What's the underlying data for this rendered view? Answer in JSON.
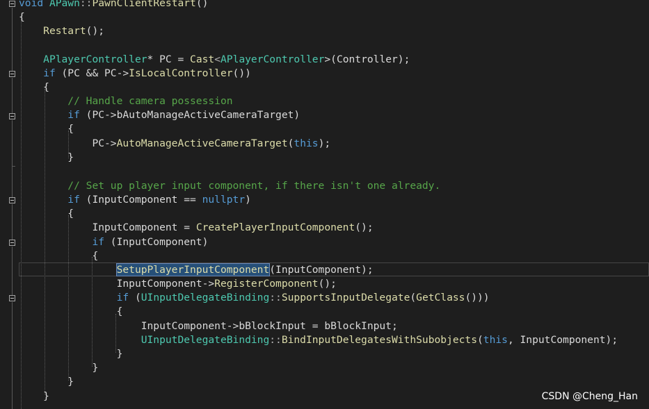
{
  "code": {
    "l1": {
      "kw": "void",
      "cls": "APawn",
      "sep": "::",
      "fn": "PawnClientRestart",
      "rest": "()"
    },
    "l2": "{",
    "l3": {
      "fn": "Restart",
      "rest": "();"
    },
    "l5": {
      "type": "APlayerController",
      "mid": "* PC = ",
      "cast": "Cast",
      "lt": "<",
      "type2": "APlayerController",
      "rest": ">(Controller);"
    },
    "l6": {
      "kw": "if",
      "a": " (PC && PC->",
      "fn": "IsLocalController",
      "b": "())"
    },
    "l7": "{",
    "l8": "// Handle camera possession",
    "l9": {
      "kw": "if",
      "a": " (PC->",
      "field": "bAutoManageActiveCameraTarget",
      "b": ")"
    },
    "l10": "{",
    "l11": {
      "a": "PC->",
      "fn": "AutoManageActiveCameraTarget",
      "b": "(",
      "kw": "this",
      "c": ");"
    },
    "l12": "}",
    "l14": "// Set up player input component, if there isn't one already.",
    "l15": {
      "kw": "if",
      "a": " (InputComponent == ",
      "kw2": "nullptr",
      "b": ")"
    },
    "l16": "{",
    "l17": {
      "a": "InputComponent = ",
      "fn": "CreatePlayerInputComponent",
      "b": "();"
    },
    "l18": {
      "kw": "if",
      "a": " (InputComponent)"
    },
    "l19": "{",
    "l20": {
      "fn": "SetupPlayerInputComponent",
      "b": "(InputComponent);"
    },
    "l21": {
      "a": "InputComponent->",
      "fn": "RegisterComponent",
      "b": "();"
    },
    "l22": {
      "kw": "if",
      "a": " (",
      "type": "UInputDelegateBinding",
      "sep": "::",
      "fn": "SupportsInputDelegate",
      "b": "(",
      "fn2": "GetClass",
      "c": "()))"
    },
    "l23": "{",
    "l24": {
      "a": "InputComponent->bBlockInput = bBlockInput;"
    },
    "l25": {
      "type": "UInputDelegateBinding",
      "sep": "::",
      "fn": "BindInputDelegatesWithSubobjects",
      "b": "(",
      "kw": "this",
      "c": ", InputComponent);"
    },
    "l26": "}",
    "l27": "}",
    "l28": "}",
    "l29": "}"
  },
  "watermark": "CSDN @Cheng_Han",
  "colors": {
    "background": "#1e1e1e",
    "keyword": "#569cd6",
    "type": "#4ec9b0",
    "function": "#dcdcaa",
    "comment": "#57a64a",
    "text": "#dcdcdc",
    "selection": "#264f78"
  }
}
